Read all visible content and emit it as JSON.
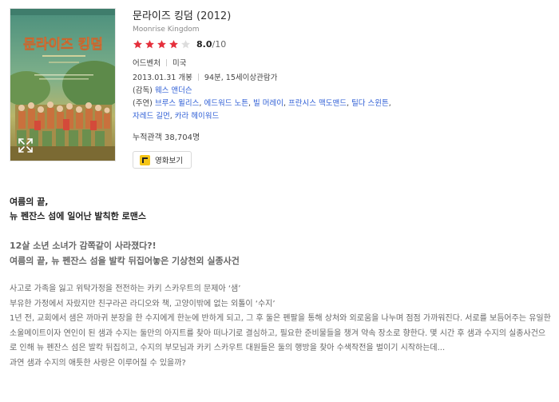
{
  "movie": {
    "title": "문라이즈 킹덤",
    "year": "(2012)",
    "original_title": "Moonrise Kingdom",
    "rating": {
      "stars_filled": 4,
      "stars_total": 5,
      "score": "8.0",
      "max": "/10",
      "star_color": "#e5303c"
    },
    "genre": "어드벤처",
    "country": "미국",
    "release": "2013.01.31 개봉",
    "runtime_rating": "94분, 15세이상관람가",
    "director_label": "(감독)",
    "director": "웨스 앤더슨",
    "cast_label": "(주연)",
    "cast": [
      "브루스 윌리스",
      "에드워드 노튼",
      "빌 머레이",
      "프란시스 맥도맨드",
      "틸다 스윈튼",
      "자레드 길먼",
      "카라 헤이워드"
    ],
    "audience": "누적관객 38,704명",
    "watch_button": "영화보기",
    "poster_title": "문라이즈 킹덤"
  },
  "story": {
    "tagline1": [
      "여름의 끝,",
      "뉴 펜잔스 섬에 일어난 발칙한 로맨스"
    ],
    "tagline2": [
      "12살 소년 소녀가 감쪽같이 사라졌다?!",
      "여름의 끝, 뉴 펜잔스 섬을 발칵 뒤집어놓은 기상천외 실종사건"
    ],
    "synopsis": [
      "사고로 가족을 잃고 위탁가정을 전전하는 카키 스카우트의 문제아 ‘샘’",
      "부유한 가정에서 자랐지만 친구라곤 라디오와 책, 고양이밖에 없는 외톨이 ‘수지’",
      "1년 전, 교회에서 샘은 까마귀 분장을 한 수지에게 한눈에 반하게 되고, 그 후 둘은 펜팔을 통해 상처와 외로움을 나누며 점점 가까워진다. 서로를 보듬어주는 유일한 소울메이트이자 연인이 된 샘과 수지는 둘만의 아지트를 찾아 떠나기로 결심하고, 필요한 준비물들을 챙겨 약속 장소로 향한다. 몇 시간 후 샘과 수지의 실종사건으로 인해 뉴 펜잔스 섬은 발칵 뒤집히고, 수지의 부모님과 카키 스카우트 대원들은 둘의 행방을 찾아 수색작전을 벌이기 시작하는데...",
      "과연 샘과 수지의 애틋한 사랑은 이루어질 수 있을까?"
    ]
  }
}
